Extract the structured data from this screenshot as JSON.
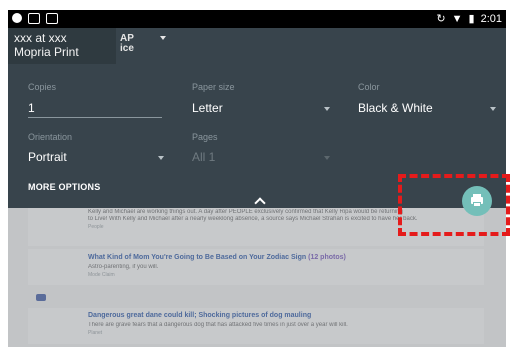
{
  "status_bar": {
    "time": "2:01"
  },
  "printer": {
    "name_line1": "xxx at xxx",
    "name_line2": "Mopria Print",
    "behind_line1": "AP",
    "behind_line2": "ice"
  },
  "fields": {
    "copies": {
      "label": "Copies",
      "value": "1"
    },
    "paper_size": {
      "label": "Paper size",
      "value": "Letter"
    },
    "color": {
      "label": "Color",
      "value": "Black & White"
    },
    "orientation": {
      "label": "Orientation",
      "value": "Portrait"
    },
    "pages": {
      "label": "Pages",
      "value": "All 1"
    }
  },
  "more_options": "MORE OPTIONS",
  "background": {
    "snippet1": "Kelly and Michael are working things out. A day after PEOPLE exclusively confirmed that Kelly Ripa would be returning",
    "snippet2": "to Live! With Kelly and Michael after a nearly weeklong absence, a source says Michael Strahan is excited to have her back.",
    "source1": "People",
    "title2": "What Kind of Mom You're Going to Be Based on Your Zodiac Sign",
    "title2_suffix": "(12 photos)",
    "snippet3": "Astro-parenting, if you will.",
    "source2": "Mode Claim",
    "title3": "Dangerous great dane could kill; Shocking pictures of dog mauling",
    "snippet4": "There are grave fears that a dangerous dog that has attacked five times in just over a year will kill.",
    "source3": "Planet"
  },
  "fab": {
    "icon": "print-icon",
    "color": "#74bfb9"
  },
  "highlight_color": "#e51b1b"
}
